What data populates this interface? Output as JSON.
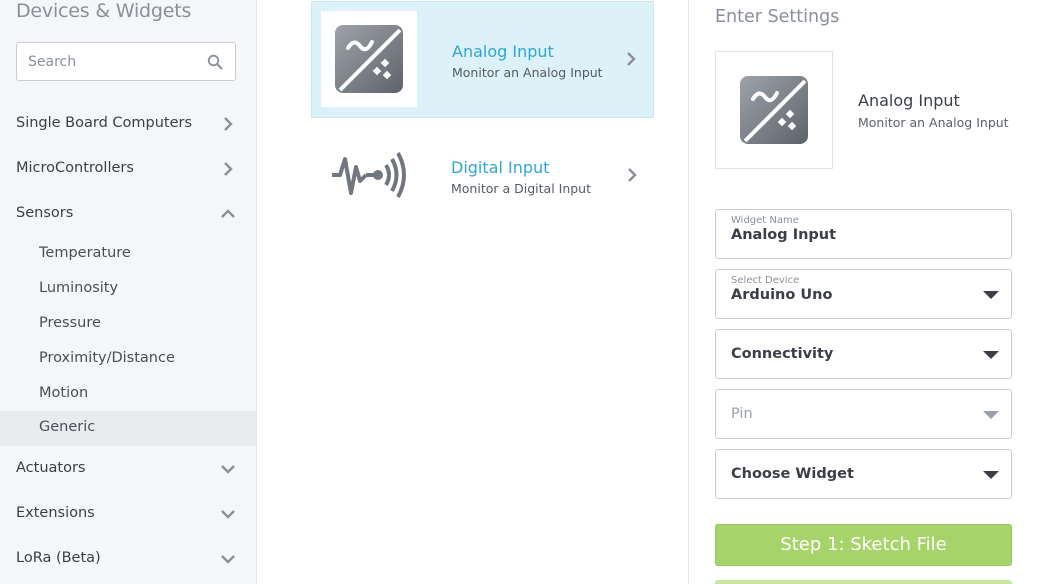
{
  "sidebar": {
    "title": "Devices & Widgets",
    "search_placeholder": "Search",
    "categories": [
      {
        "label": "Single Board Computers",
        "state": "collapsed"
      },
      {
        "label": "MicroControllers",
        "state": "collapsed"
      },
      {
        "label": "Sensors",
        "state": "expanded",
        "children": [
          "Temperature",
          "Luminosity",
          "Pressure",
          "Proximity/Distance",
          "Motion",
          "Generic"
        ],
        "active_child": "Generic"
      },
      {
        "label": "Actuators",
        "state": "collapsed"
      },
      {
        "label": "Extensions",
        "state": "collapsed"
      },
      {
        "label": "LoRa (Beta)",
        "state": "collapsed"
      }
    ]
  },
  "widgets": [
    {
      "title": "Analog Input",
      "description": "Monitor an Analog Input",
      "icon": "analog-input-icon",
      "selected": true
    },
    {
      "title": "Digital Input",
      "description": "Monitor a Digital Input",
      "icon": "digital-input-icon",
      "selected": false
    }
  ],
  "settings": {
    "title": "Enter Settings",
    "preview": {
      "title": "Analog Input",
      "description": "Monitor an Analog Input"
    },
    "widget_name": {
      "label": "Widget Name",
      "value": "Analog Input"
    },
    "select_device": {
      "label": "Select Device",
      "value": "Arduino Uno"
    },
    "connectivity": {
      "value": "Connectivity"
    },
    "pin": {
      "value": "Pin"
    },
    "choose_widget": {
      "value": "Choose Widget"
    },
    "step_button": "Step 1: Sketch File"
  },
  "colors": {
    "accent_blue": "#30a6d6",
    "selected_bg": "#ddf1f9",
    "step_green": "#a6d46a",
    "sidebar_bg": "#f5f6f8"
  }
}
